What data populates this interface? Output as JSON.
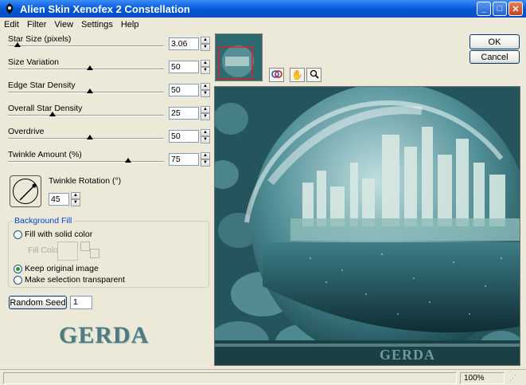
{
  "window": {
    "title": "Alien Skin Xenofex 2 Constellation"
  },
  "menu": [
    "Edit",
    "Filter",
    "View",
    "Settings",
    "Help"
  ],
  "sliders": [
    {
      "label": "Star Size (pixels)",
      "value": "3.06",
      "position": 0.02
    },
    {
      "label": "Size Variation",
      "value": "50",
      "position": 0.5
    },
    {
      "label": "Edge Star Density",
      "value": "50",
      "position": 0.5
    },
    {
      "label": "Overall Star Density",
      "value": "25",
      "position": 0.25
    },
    {
      "label": "Overdrive",
      "value": "50",
      "position": 0.5
    },
    {
      "label": "Twinkle Amount (%)",
      "value": "75",
      "position": 0.75
    }
  ],
  "twinkle_rotation": {
    "label": "Twinkle Rotation (°)",
    "value": "45"
  },
  "background_fill": {
    "legend": "Background Fill",
    "option_solid": "Fill with solid color",
    "fill_color_label": "Fill Color",
    "option_keep": "Keep original image",
    "option_transparent": "Make selection transparent",
    "selected": "keep"
  },
  "random_seed": {
    "button_label": "Random Seed",
    "value": "1"
  },
  "watermark": "GERDA",
  "preview_watermark": "GERDA",
  "buttons": {
    "ok": "OK",
    "cancel": "Cancel"
  },
  "status": {
    "zoom": "100%"
  },
  "colors": {
    "titlebar": "#0a5fe0",
    "legend_text": "#0046d5",
    "preview_teal": "#2a7c84"
  }
}
